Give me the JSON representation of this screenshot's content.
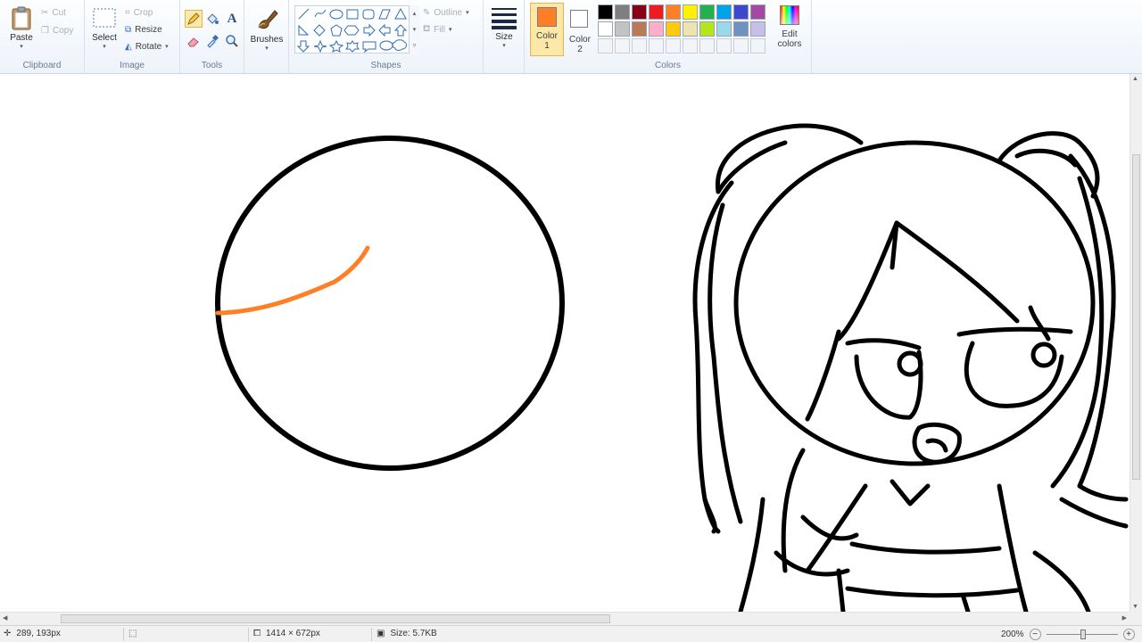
{
  "ribbon": {
    "clipboard": {
      "group_label": "Clipboard",
      "paste": "Paste",
      "cut": "Cut",
      "copy": "Copy"
    },
    "image": {
      "group_label": "Image",
      "select": "Select",
      "crop": "Crop",
      "resize": "Resize",
      "rotate": "Rotate"
    },
    "tools": {
      "group_label": "Tools",
      "active_tool": "pencil"
    },
    "brushes": {
      "label": "Brushes"
    },
    "shapes": {
      "group_label": "Shapes",
      "outline": "Outline",
      "fill": "Fill"
    },
    "size": {
      "label": "Size"
    },
    "colors": {
      "group_label": "Colors",
      "color1_label": "Color 1",
      "color1_line1": "Color",
      "color1_line2": "1",
      "color2_line1": "Color",
      "color2_line2": "2",
      "color1": "#ff7f27",
      "color2": "#ffffff",
      "edit_line1": "Edit",
      "edit_line2": "colors",
      "palette_row1": [
        "#000000",
        "#7f7f7f",
        "#880015",
        "#ed1c24",
        "#ff7f27",
        "#fff200",
        "#22b14c",
        "#00a2e8",
        "#3f48cc",
        "#a349a4"
      ],
      "palette_row2": [
        "#ffffff",
        "#c3c3c3",
        "#b97a57",
        "#ffaec9",
        "#ffc90e",
        "#efe4b0",
        "#b5e61d",
        "#99d9ea",
        "#7092be",
        "#c8bfe7"
      ]
    }
  },
  "status": {
    "cursor_position": "289, 193px",
    "canvas_size": "1414 × 672px",
    "file_size": "Size: 5.7KB",
    "zoom": "200%"
  },
  "scroll": {
    "horizontal_position": 0.0,
    "vertical_position": 0.0
  },
  "colors": {
    "stroke": "#000000",
    "accent_stroke": "#ff7f27",
    "ribbon_bg": "#f3f7fc"
  }
}
